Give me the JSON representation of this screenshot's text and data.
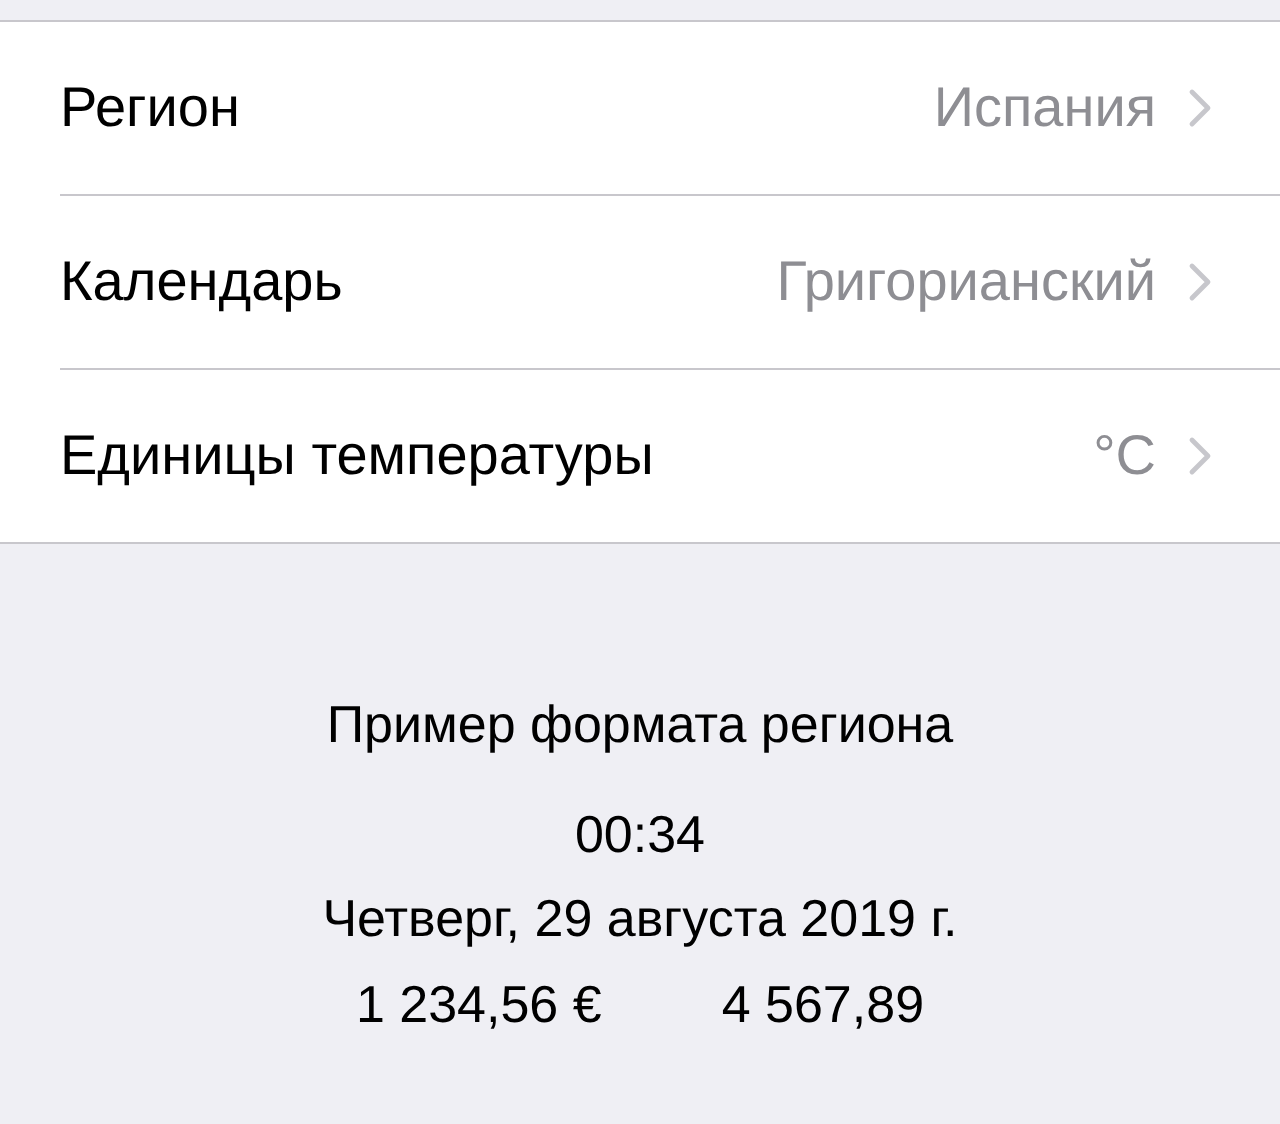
{
  "settings": [
    {
      "label": "Регион",
      "value": "Испания"
    },
    {
      "label": "Календарь",
      "value": "Григорианский"
    },
    {
      "label": "Единицы температуры",
      "value": "°C"
    }
  ],
  "format_example": {
    "title": "Пример формата региона",
    "time": "00:34",
    "date": "Четверг, 29 августа 2019 г.",
    "numbers": [
      "1 234,56 €",
      "4 567,89"
    ]
  }
}
